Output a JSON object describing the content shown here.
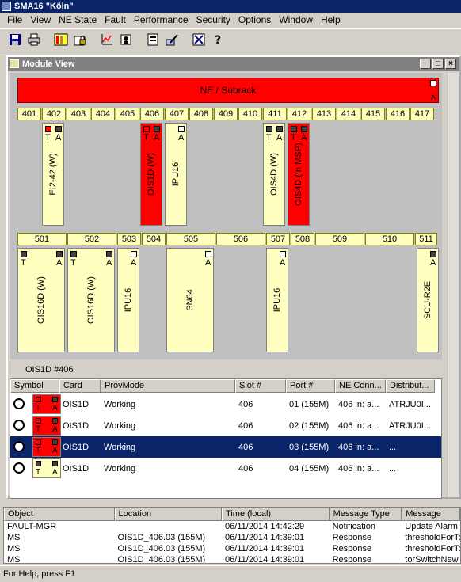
{
  "window": {
    "title": "SMA16 \"Köln\""
  },
  "menu": [
    "File",
    "View",
    "NE State",
    "Fault",
    "Performance",
    "Security",
    "Options",
    "Window",
    "Help"
  ],
  "toolbar": {
    "icons": [
      "save-icon",
      "print-icon",
      "module-view-icon",
      "security-lock-icon",
      "chart-icon",
      "access-icon",
      "config-icon",
      "edit-icon",
      "disconnect-icon",
      "help-icon"
    ]
  },
  "module_view": {
    "title": "Module View",
    "subrack_label": "NE / Subrack",
    "subrack_alarm": "A",
    "top_slots": [
      "401",
      "402",
      "403",
      "404",
      "405",
      "406",
      "407",
      "408",
      "409",
      "410",
      "411",
      "412",
      "413",
      "414",
      "415",
      "416",
      "417"
    ],
    "top_cards": [
      {
        "name": "EI2-42 (W)",
        "t": "T",
        "a": "A",
        "color": "#ffffc0"
      },
      {
        "name": "OIS1D (W)",
        "t": "T",
        "a": "A",
        "color": "#ff0000"
      },
      {
        "name": "IPU16",
        "t": "",
        "a": "A",
        "color": "#ffffc0"
      },
      {
        "name": "OIS4D (W)",
        "t": "T",
        "a": "A",
        "color": "#ffffc0"
      },
      {
        "name": "OIS4D (In MSP)",
        "t": "T",
        "a": "A",
        "color": "#ff0000"
      }
    ],
    "bottom_slots": [
      "501",
      "502",
      "503",
      "504",
      "505",
      "506",
      "507",
      "508",
      "509",
      "510",
      "511"
    ],
    "bottom_cards": [
      {
        "name": "OIS16D (W)",
        "t": "T",
        "a": "A"
      },
      {
        "name": "OIS16D (W)",
        "t": "T",
        "a": "A"
      },
      {
        "name": "IPU16",
        "t": "",
        "a": "A"
      },
      {
        "name": "SN64",
        "t": "",
        "a": "A"
      },
      {
        "name": "IPU16",
        "t": "",
        "a": "A"
      },
      {
        "name": "SCU-R2E",
        "t": "",
        "a": "A"
      }
    ]
  },
  "detail": {
    "header": "OIS1D #406",
    "columns": [
      "Symbol",
      "Card",
      "ProvMode",
      "Slot #",
      "Port #",
      "NE Conn...",
      "Distribut..."
    ],
    "rows": [
      {
        "card": "OIS1D",
        "provmode": "Working",
        "slot": "406",
        "port": "01 (155M)",
        "neconn": "406 in: a...",
        "distrib": "ATRJU0I...",
        "symbol_color": "red",
        "selected": false
      },
      {
        "card": "OIS1D",
        "provmode": "Working",
        "slot": "406",
        "port": "02 (155M)",
        "neconn": "406 in: a...",
        "distrib": "ATRJU0I...",
        "symbol_color": "red",
        "selected": false
      },
      {
        "card": "OIS1D",
        "provmode": "Working",
        "slot": "406",
        "port": "03 (155M)",
        "neconn": "406 in: a...",
        "distrib": "...",
        "symbol_color": "red",
        "selected": true
      },
      {
        "card": "OIS1D",
        "provmode": "Working",
        "slot": "406",
        "port": "04 (155M)",
        "neconn": "406 in: a...",
        "distrib": "...",
        "symbol_color": "yellow",
        "selected": false
      }
    ]
  },
  "log": {
    "columns": [
      "Object",
      "Location",
      "Time (local)",
      "Message Type",
      "Message"
    ],
    "rows": [
      {
        "object": "FAULT-MGR",
        "location": "",
        "time": "06/11/2014 14:42:29",
        "type": "Notification",
        "message": "Update Alarm I"
      },
      {
        "object": "MS",
        "location": "OIS1D_406.03 (155M)",
        "time": "06/11/2014 14:39:01",
        "type": "Response",
        "message": "thresholdForTo"
      },
      {
        "object": "MS",
        "location": "OIS1D_406.03 (155M)",
        "time": "06/11/2014 14:39:01",
        "type": "Response",
        "message": "thresholdForTo"
      },
      {
        "object": "MS",
        "location": "OIS1D_406.03 (155M)",
        "time": "06/11/2014 14:39:01",
        "type": "Response",
        "message": "torSwitchNew"
      }
    ]
  },
  "status": {
    "text": "For Help, press F1"
  }
}
